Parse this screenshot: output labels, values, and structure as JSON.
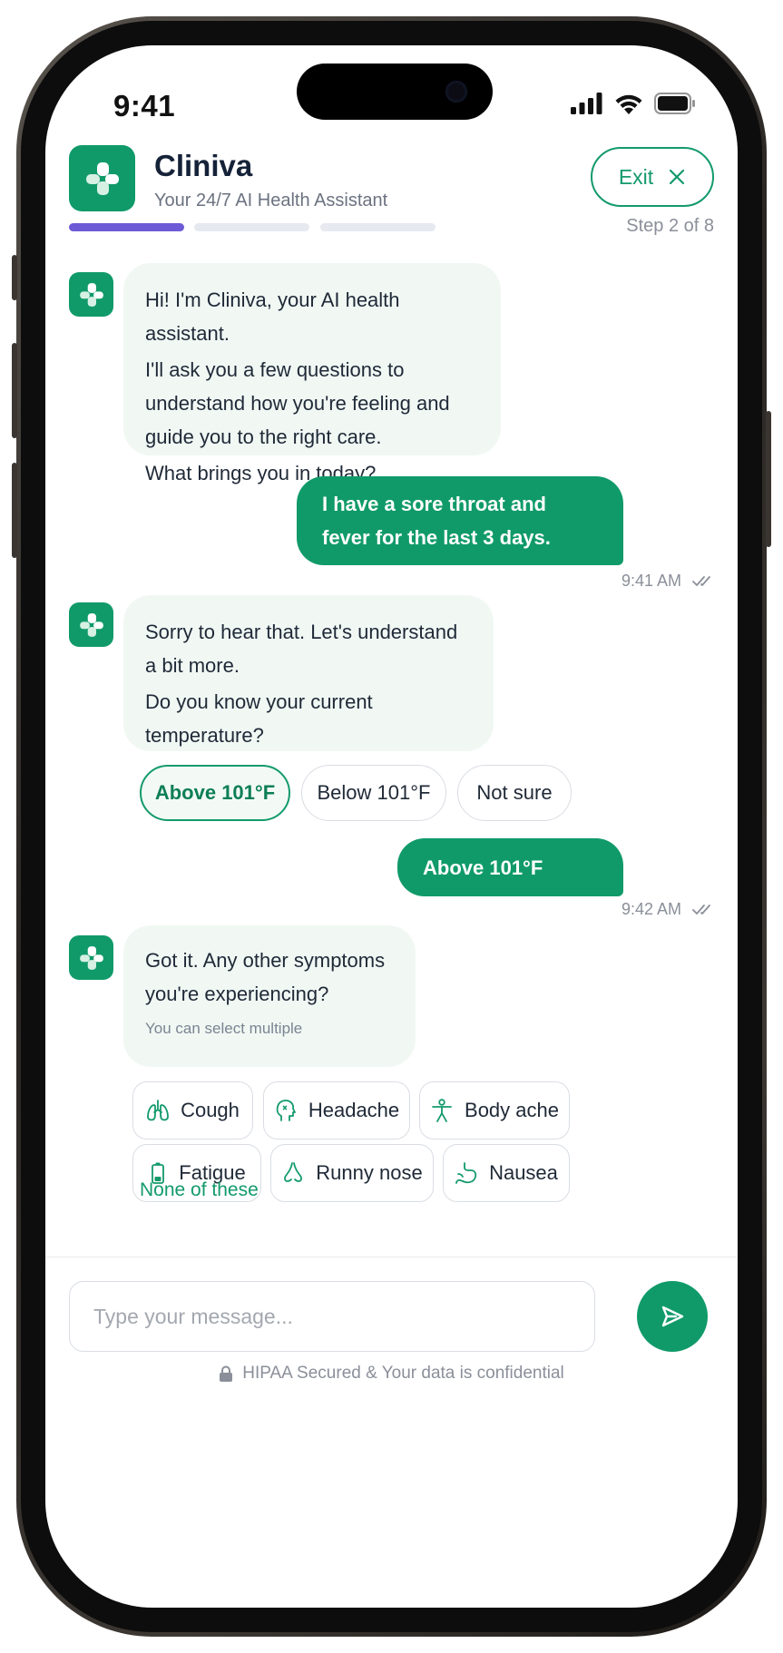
{
  "status_bar": {
    "time": "9:41"
  },
  "header": {
    "app_name": "Cliniva",
    "subtitle": "Your 24/7 AI Health Assistant",
    "exit_label": "Exit"
  },
  "progress": {
    "step_text": "Step 2 of 8",
    "current_step": 2,
    "total_steps": 8,
    "segments": 3,
    "active_segments": 1
  },
  "colors": {
    "brand": "#109a6a",
    "progress": "#6c5ad6",
    "bot_bubble": "#f1f8f4"
  },
  "messages": {
    "bot1": {
      "line1": "Hi! I'm Cliniva, your AI health assistant.",
      "line2": "I'll ask you a few questions to understand how you're feeling and guide you to the right care.",
      "line3": "What brings you in today?"
    },
    "user1": {
      "text": "I have a sore throat and fever for the last 3 days.",
      "time": "9:41 AM"
    },
    "bot2": {
      "line1": "Sorry to hear that. Let's understand a bit more.",
      "line2": "Do you know your current temperature?"
    },
    "temp_options": [
      "Above 101°F",
      "Below 101°F",
      "Not sure"
    ],
    "temp_selected": "Above 101°F",
    "user2": {
      "text": "Above 101°F",
      "time": "9:42 AM"
    },
    "bot3": {
      "line1": "Got it. Any other symptoms you're experiencing?",
      "hint": "You can select multiple"
    },
    "symptoms": [
      {
        "label": "Cough",
        "icon": "lungs-icon"
      },
      {
        "label": "Headache",
        "icon": "head-icon"
      },
      {
        "label": "Body ache",
        "icon": "body-icon"
      },
      {
        "label": "Fatigue",
        "icon": "battery-low-icon"
      },
      {
        "label": "Runny nose",
        "icon": "nose-icon"
      },
      {
        "label": "Nausea",
        "icon": "stomach-icon"
      }
    ],
    "none_label": "None of these"
  },
  "composer": {
    "placeholder": "Type your message...",
    "footer": "HIPAA Secured & Your data is confidential"
  }
}
